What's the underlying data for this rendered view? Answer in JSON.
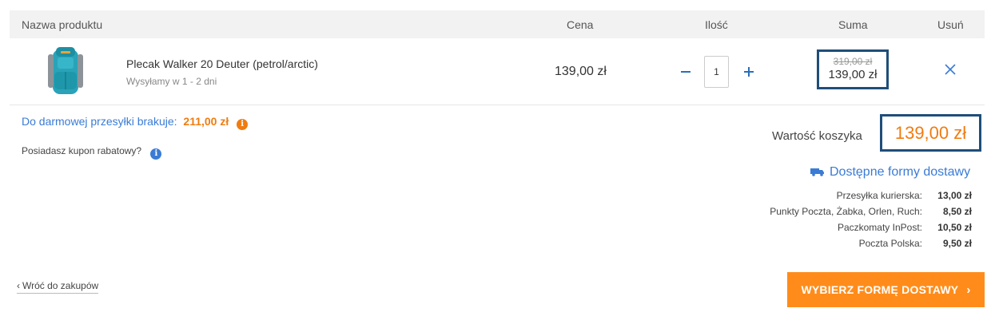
{
  "table_header": {
    "product": "Nazwa produktu",
    "price": "Cena",
    "quantity": "Ilość",
    "sum": "Suma",
    "remove": "Usuń"
  },
  "item": {
    "name": "Plecak Walker 20 Deuter (petrol/arctic)",
    "shipping": "Wysyłamy w 1 - 2 dni",
    "price": "139,00 zł",
    "quantity": "1",
    "sum_old": "319,00 zł",
    "sum_new": "139,00 zł",
    "thumbnail_icon": "backpack-image"
  },
  "free_shipping": {
    "label": "Do darmowej przesyłki brakuje:",
    "amount": "211,00 zł"
  },
  "coupon": {
    "label": "Posiadasz kupon rabatowy?"
  },
  "cart_value": {
    "label": "Wartość koszyka",
    "amount": "139,00 zł"
  },
  "delivery": {
    "title": "Dostępne formy dostawy",
    "options": [
      {
        "name": "Przesyłka kurierska:",
        "price": "13,00 zł"
      },
      {
        "name": "Punkty Poczta, Żabka, Orlen, Ruch:",
        "price": "8,50 zł"
      },
      {
        "name": "Paczkomaty InPost:",
        "price": "10,50 zł"
      },
      {
        "name": "Poczta Polska:",
        "price": "9,50 zł"
      }
    ]
  },
  "footer": {
    "back_label": "Wróć do zakupów",
    "choose_label": "WYBIERZ FORMĘ DOSTAWY"
  },
  "colors": {
    "accent_orange": "#f07c10",
    "button_orange": "#ff8c1a",
    "link_blue": "#3a7bd5",
    "highlight_border": "#1f4e79"
  }
}
